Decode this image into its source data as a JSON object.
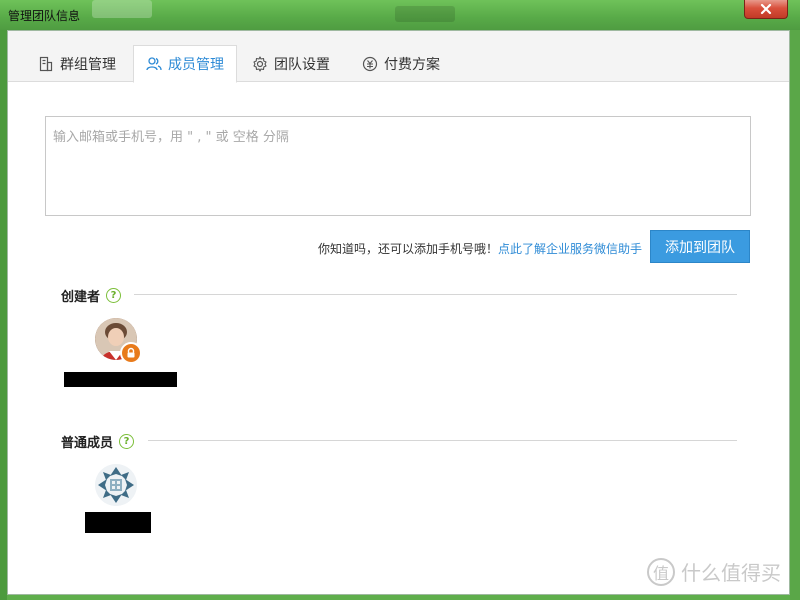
{
  "window": {
    "title": "管理团队信息"
  },
  "tabs": [
    {
      "label": "群组管理",
      "icon": "group-list-icon"
    },
    {
      "label": "成员管理",
      "icon": "members-icon",
      "active": true
    },
    {
      "label": "团队设置",
      "icon": "gear-icon"
    },
    {
      "label": "付费方案",
      "icon": "payment-icon"
    }
  ],
  "invite": {
    "placeholder": "输入邮箱或手机号，用 \" , \" 或 空格 分隔",
    "value": "",
    "tip_text": "你知道吗，还可以添加手机号哦！",
    "tip_link": "点此了解企业服务微信助手",
    "add_button": "添加到团队"
  },
  "creator_section": {
    "title": "创建者",
    "help": "?"
  },
  "members_section": {
    "title": "普通成员",
    "help": "?"
  },
  "watermark": {
    "logo": "值",
    "text": "什么值得买"
  },
  "colors": {
    "accent": "#2e8bd6",
    "button": "#3b9be0",
    "help_green": "#7cbf3a",
    "lock_orange": "#e87b1c"
  }
}
